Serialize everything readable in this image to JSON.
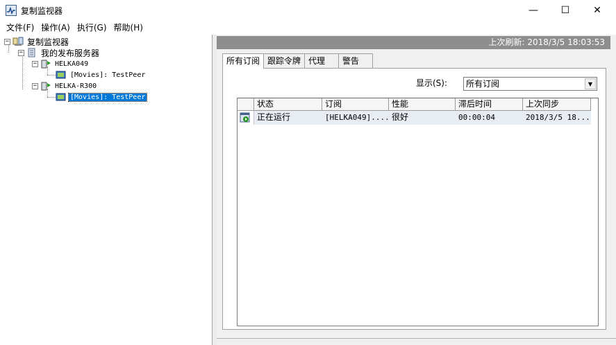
{
  "window": {
    "title": "复制监视器",
    "minimize_glyph": "—",
    "maximize_glyph": "☐",
    "close_glyph": "✕"
  },
  "menu": {
    "items": [
      {
        "label": "文件(F)"
      },
      {
        "label": "操作(A)"
      },
      {
        "label": "执行(G)"
      },
      {
        "label": "帮助(H)"
      }
    ]
  },
  "tree": {
    "root": "复制监视器",
    "publishers": "我的发布服务器",
    "server1": "HELKA049",
    "server1_pub": "[Movies]: TestPeer",
    "server2": "HELKA-R300",
    "server2_pub": "[Movies]: TestPeer"
  },
  "status": {
    "last_refresh": "上次刷新: 2018/3/5 18:03:53"
  },
  "tabs": [
    {
      "label": "所有订阅",
      "active": true
    },
    {
      "label": "跟踪令牌",
      "active": false
    },
    {
      "label": "代理",
      "active": false
    },
    {
      "label": "警告",
      "active": false
    }
  ],
  "filter": {
    "label": "显示(S):",
    "value": "所有订阅"
  },
  "grid": {
    "columns": [
      "状态",
      "订阅",
      "性能",
      "滞后时间",
      "上次同步"
    ],
    "rows": [
      {
        "icon": "running-subscription-icon",
        "status": "正在运行",
        "subscription": "[HELKA049]....",
        "performance": "很好",
        "latency": "00:00:04",
        "last_sync": "2018/3/5 18..."
      }
    ]
  },
  "colors": {
    "selection": "#0078d7",
    "refresh_bar": "#8e8e8e",
    "row_highlight": "#e8edf3"
  }
}
